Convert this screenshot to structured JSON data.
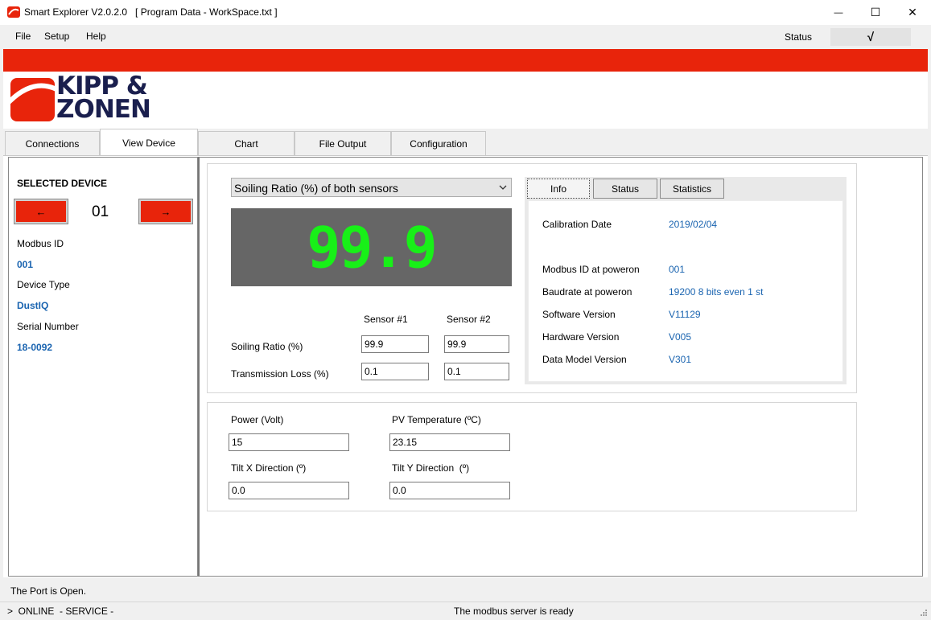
{
  "window": {
    "title": "Smart Explorer V2.0.2.0   [ Program Data - WorkSpace.txt ]",
    "minimize_glyph": "—",
    "maximize_glyph": "☐",
    "close_glyph": "✕"
  },
  "menu": {
    "file": "File",
    "setup": "Setup",
    "help": "Help",
    "status_label": "Status",
    "status_value": "√"
  },
  "brand": {
    "line1": "KIPP &",
    "line2": "ZONEN",
    "accent_color": "#e8240b",
    "text_color": "#1a1f4e"
  },
  "tabs": [
    {
      "label": "Connections"
    },
    {
      "label": "View Device"
    },
    {
      "label": "Chart"
    },
    {
      "label": "File Output"
    },
    {
      "label": "Configuration"
    }
  ],
  "left_panel": {
    "selected_device_label": "SELECTED DEVICE",
    "device_number": "01",
    "prev_glyph": "←",
    "next_glyph": "→",
    "modbus_id_label": "Modbus ID",
    "modbus_id_value": "001",
    "device_type_label": "Device Type",
    "device_type_value": "DustIQ",
    "serial_label": "Serial Number",
    "serial_value": "18-0092"
  },
  "measurement": {
    "dropdown_value": "Soiling Ratio (%) of both sensors",
    "big_value": "99.9",
    "sensor1_header": "Sensor #1",
    "sensor2_header": "Sensor #2",
    "rows": [
      {
        "label": "Soiling Ratio (%)",
        "s1": "99.9",
        "s2": "99.9"
      },
      {
        "label": "Transmission Loss (%)",
        "s1": "0.1",
        "s2": "0.1"
      }
    ]
  },
  "info": {
    "tabs": [
      "Info",
      "Status",
      "Statistics"
    ],
    "calibration_label": "Calibration Date",
    "calibration_value": "2019/02/04",
    "items": [
      {
        "label": "Modbus ID at poweron",
        "value": "001"
      },
      {
        "label": "Baudrate at poweron",
        "value": "19200 8 bits even 1 st"
      },
      {
        "label": "Software Version",
        "value": "V11129"
      },
      {
        "label": "Hardware Version",
        "value": "V005"
      },
      {
        "label": "Data Model Version",
        "value": "V301"
      }
    ]
  },
  "extras": {
    "power_label": "Power (Volt)",
    "power_value": "15",
    "pv_temp_label": "PV Temperature (ºC)",
    "pv_temp_value": "23.15",
    "tilt_x_label": "Tilt X Direction (º)",
    "tilt_x_value": "0.0",
    "tilt_y_label": "Tilt Y Direction  (º)",
    "tilt_y_value": "0.0"
  },
  "footer": {
    "port_status": "The Port is Open.",
    "mode": ">  ONLINE  - SERVICE -",
    "server_status": "The modbus server is ready"
  }
}
